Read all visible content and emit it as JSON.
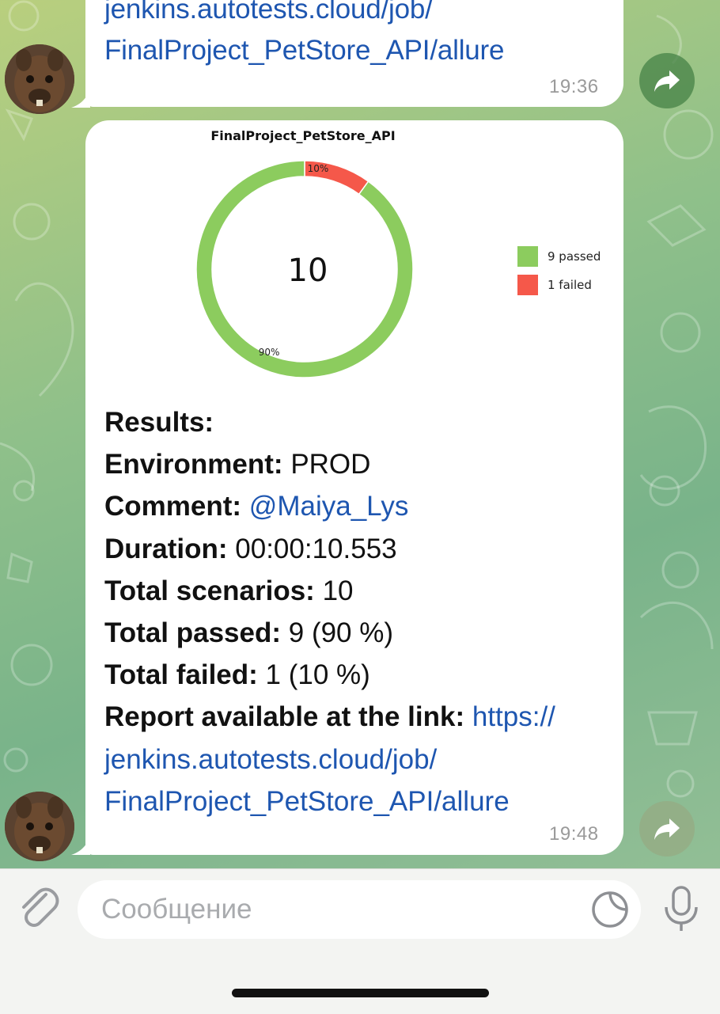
{
  "messages": [
    {
      "link_lines": [
        "jenkins.autotests.cloud/job/",
        "FinalProject_PetStore_API/allure"
      ],
      "time": "19:36"
    },
    {
      "chart_title": "FinalProject_PetStore_API",
      "results": {
        "heading": "Results:",
        "environment_label": "Environment:",
        "environment_value": "PROD",
        "comment_label": "Comment:",
        "comment_value": "@Maiya_Lys",
        "duration_label": "Duration:",
        "duration_value": "00:00:10.553",
        "total_scenarios_label": "Total scenarios:",
        "total_scenarios_value": "10",
        "total_passed_label": "Total passed:",
        "total_passed_value": "9 (90 %)",
        "total_failed_label": "Total failed:",
        "total_failed_value": "1 (10 %)",
        "report_label": "Report available at the link:",
        "report_link_lines": [
          "https://",
          "jenkins.autotests.cloud/job/",
          "FinalProject_PetStore_API/allure"
        ]
      },
      "time": "19:48"
    }
  ],
  "chart_data": {
    "type": "pie",
    "title": "FinalProject_PetStore_API",
    "center_label": "10",
    "categories": [
      "passed",
      "failed"
    ],
    "values": [
      9,
      1
    ],
    "percent_labels": [
      "90%",
      "10%"
    ],
    "legend": [
      "9 passed",
      "1 failed"
    ],
    "colors": [
      "#8ccc5e",
      "#f5584a"
    ],
    "legend_position": "right",
    "donut": true
  },
  "input": {
    "placeholder": "Сообщение"
  },
  "icons": {
    "attach": "paperclip-icon",
    "sticker": "sticker-icon",
    "mic": "microphone-icon",
    "forward": "forward-arrow-icon",
    "avatar": "llama-avatar"
  }
}
